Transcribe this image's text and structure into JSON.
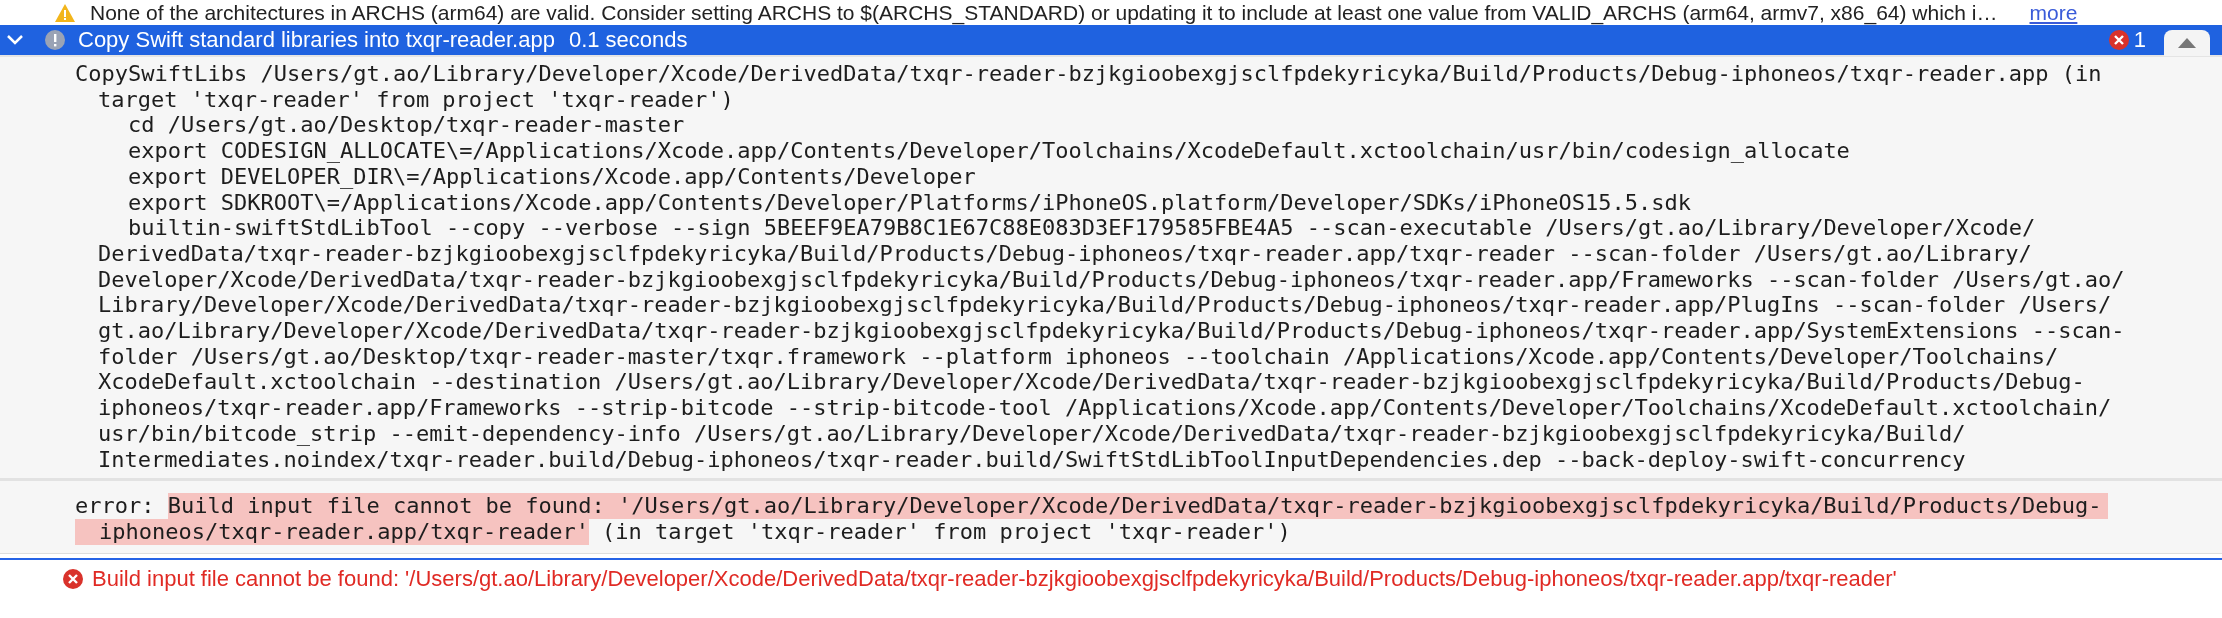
{
  "warning": {
    "text": "None of the architectures in ARCHS (arm64) are valid. Consider setting ARCHS to $(ARCHS_STANDARD) or updating it to include at least one value from VALID_ARCHS (arm64, armv7, x86_64) which i…",
    "link": "more"
  },
  "step": {
    "expanded": true,
    "title": "Copy Swift standard libraries into txqr-reader.app",
    "duration": "0.1 seconds",
    "error_count": "1"
  },
  "log_lines": [
    {
      "kind": "command",
      "text": "CopySwiftLibs /Users/gt.ao/Library/Developer/Xcode/DerivedData/txqr-reader-bzjkgioobexgjsclfpdekyricyka/Build/Products/Debug-iphoneos/txqr-reader.app (in"
    },
    {
      "kind": "wrap",
      "text": "target 'txqr-reader' from project 'txqr-reader')"
    },
    {
      "kind": "sub",
      "text": "cd /Users/gt.ao/Desktop/txqr-reader-master"
    },
    {
      "kind": "sub",
      "text": "export CODESIGN_ALLOCATE\\=/Applications/Xcode.app/Contents/Developer/Toolchains/XcodeDefault.xctoolchain/usr/bin/codesign_allocate"
    },
    {
      "kind": "sub",
      "text": "export DEVELOPER_DIR\\=/Applications/Xcode.app/Contents/Developer"
    },
    {
      "kind": "sub",
      "text": "export SDKROOT\\=/Applications/Xcode.app/Contents/Developer/Platforms/iPhoneOS.platform/Developer/SDKs/iPhoneOS15.5.sdk"
    },
    {
      "kind": "sub",
      "text": "builtin-swiftStdLibTool --copy --verbose --sign 5BEEF9EA79B8C1E67C88E083D3EF179585FBE4A5 --scan-executable /Users/gt.ao/Library/Developer/Xcode/"
    },
    {
      "kind": "wrap",
      "text": "DerivedData/txqr-reader-bzjkgioobexgjsclfpdekyricyka/Build/Products/Debug-iphoneos/txqr-reader.app/txqr-reader --scan-folder /Users/gt.ao/Library/"
    },
    {
      "kind": "wrap",
      "text": "Developer/Xcode/DerivedData/txqr-reader-bzjkgioobexgjsclfpdekyricyka/Build/Products/Debug-iphoneos/txqr-reader.app/Frameworks --scan-folder /Users/gt.ao/"
    },
    {
      "kind": "wrap",
      "text": "Library/Developer/Xcode/DerivedData/txqr-reader-bzjkgioobexgjsclfpdekyricyka/Build/Products/Debug-iphoneos/txqr-reader.app/PlugIns --scan-folder /Users/"
    },
    {
      "kind": "wrap",
      "text": "gt.ao/Library/Developer/Xcode/DerivedData/txqr-reader-bzjkgioobexgjsclfpdekyricyka/Build/Products/Debug-iphoneos/txqr-reader.app/SystemExtensions --scan-"
    },
    {
      "kind": "wrap",
      "text": "folder /Users/gt.ao/Desktop/txqr-reader-master/txqr.framework --platform iphoneos --toolchain /Applications/Xcode.app/Contents/Developer/Toolchains/"
    },
    {
      "kind": "wrap",
      "text": "XcodeDefault.xctoolchain --destination /Users/gt.ao/Library/Developer/Xcode/DerivedData/txqr-reader-bzjkgioobexgjsclfpdekyricyka/Build/Products/Debug-"
    },
    {
      "kind": "wrap",
      "text": "iphoneos/txqr-reader.app/Frameworks --strip-bitcode --strip-bitcode-tool /Applications/Xcode.app/Contents/Developer/Toolchains/XcodeDefault.xctoolchain/"
    },
    {
      "kind": "wrap",
      "text": "usr/bin/bitcode_strip --emit-dependency-info /Users/gt.ao/Library/Developer/Xcode/DerivedData/txqr-reader-bzjkgioobexgjsclfpdekyricyka/Build/"
    },
    {
      "kind": "wrap",
      "text": "Intermediates.noindex/txqr-reader.build/Debug-iphoneos/txqr-reader.build/SwiftStdLibToolInputDependencies.dep --back-deploy-swift-concurrency"
    }
  ],
  "error": {
    "label": "error:",
    "highlighted": [
      "Build input file cannot be found: '/Users/gt.ao/Library/Developer/Xcode/DerivedData/txqr-reader-bzjkgioobexgjsclfpdekyricyka/Build/Products/Debug-",
      "iphoneos/txqr-reader.app/txqr-reader'"
    ],
    "context": "(in target 'txqr-reader' from project 'txqr-reader')"
  },
  "issue": {
    "text": "Build input file cannot be found: '/Users/gt.ao/Library/Developer/Xcode/DerivedData/txqr-reader-bzjkgioobexgjsclfpdekyricyka/Build/Products/Debug-iphoneos/txqr-reader.app/txqr-reader'"
  }
}
